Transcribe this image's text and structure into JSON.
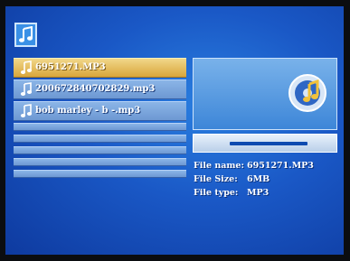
{
  "files": [
    {
      "name": "6951271.MP3",
      "selected": true
    },
    {
      "name": "200672840702829.mp3",
      "selected": false
    },
    {
      "name": "bob marley - b -.mp3",
      "selected": false
    }
  ],
  "empty_rows": 5,
  "info": {
    "name_label": "File name:",
    "name_value": "6951271.MP3",
    "size_label": "File Size:",
    "size_value": "6MB",
    "type_label": "File type:",
    "type_value": "MP3"
  },
  "colors": {
    "background": "#1a58c6",
    "row": "#7ea8de",
    "row_selected": "#e3b95a",
    "progress_fill": "#0e4bb0"
  },
  "icons": {
    "app": "music-note-icon",
    "file": "music-note-icon",
    "preview": "music-disc-icon"
  },
  "progress_fraction": 0.54
}
